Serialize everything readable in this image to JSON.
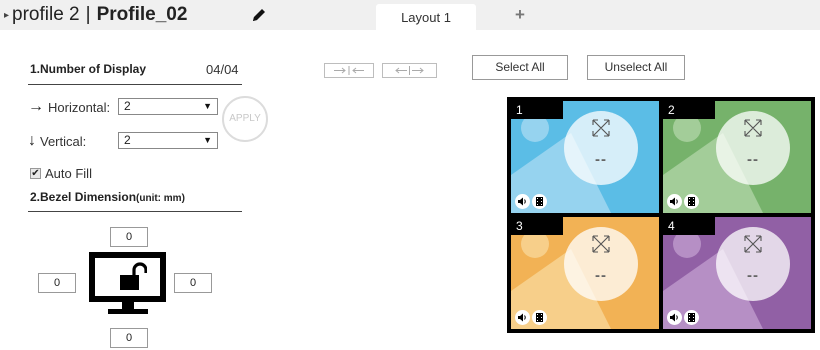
{
  "header": {
    "arrow": "▸",
    "profile_label": "profile 2",
    "separator": "|",
    "profile_name": "Profile_02",
    "tabs": [
      {
        "label": "Layout 1",
        "active": true
      }
    ],
    "add_tab_label": "+"
  },
  "display_settings": {
    "section_title": "1.Number of Display",
    "count": "04/04",
    "horizontal": {
      "arrow": "→",
      "label": "Horizontal:",
      "value": "2"
    },
    "vertical": {
      "arrow": "↓",
      "label": "Vertical:",
      "value": "2"
    },
    "caret": "▼",
    "apply_label": "APPLY",
    "auto_fill": {
      "label": "Auto Fill",
      "checked": true,
      "check_mark": "✔"
    }
  },
  "bezel": {
    "title": "2.Bezel Dimension",
    "unit": "(unit: mm)",
    "top": "0",
    "left": "0",
    "right": "0",
    "bottom": "0"
  },
  "buttons": {
    "select_all": "Select All",
    "unselect_all": "Unselect All"
  },
  "cells": [
    {
      "number": "1",
      "source": "--",
      "bg": "#5bbde6",
      "hill": "#96d3ef",
      "sun": "#96d3ef"
    },
    {
      "number": "2",
      "source": "--",
      "bg": "#76b26b",
      "hill": "#a3cd99",
      "sun": "#a3cd99"
    },
    {
      "number": "3",
      "source": "--",
      "bg": "#f2b255",
      "hill": "#f7cf8a",
      "sun": "#f7cf8a"
    },
    {
      "number": "4",
      "source": "--",
      "bg": "#9160a5",
      "hill": "#b68fc5",
      "sun": "#b68fc5"
    }
  ],
  "icons": {
    "title_arrow": "caret-right-icon",
    "pencil": "pencil-icon",
    "add_tab": "plus-icon",
    "unlock": "unlock-icon",
    "merge": "merge-arrows-icon",
    "split": "split-arrows-icon",
    "expand": "expand-icon",
    "speaker": "speaker-icon",
    "film": "film-icon"
  },
  "colors": {
    "topbar_bg": "#f0f0f0",
    "apply_disabled": "#c8c8c8",
    "grid_frame": "#000000"
  }
}
